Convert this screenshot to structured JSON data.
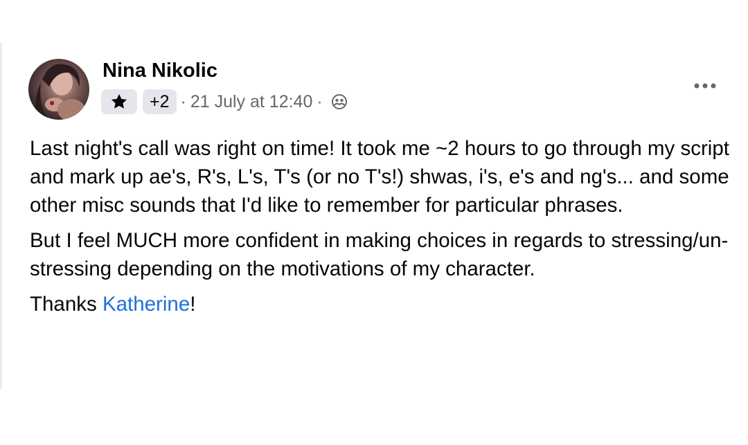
{
  "post": {
    "author_name": "Nina Nikolic",
    "badge_extra_count": "+2",
    "separator": "·",
    "timestamp": "21 July at 12:40",
    "privacy_icon": "friends-audience-icon",
    "badge_icon": "star-icon",
    "more_icon": "more-options-icon",
    "paragraphs": [
      "Last night's call was right on time! It took me ~2 hours to go through my script and mark up ae's, R's, L's, T's (or no T's!) shwas, i's, e's and ng's... and some other misc sounds that I'd like to remember for particular phrases.",
      "But I feel MUCH more confident in making choices in regards to stressing/un-stressing depending on the motivations of my character."
    ],
    "thanks_prefix": "Thanks ",
    "mention_name": "Katherine",
    "thanks_suffix": "!",
    "colors": {
      "text": "#050505",
      "secondary_text": "#65676b",
      "mention": "#216fdb",
      "badge_bg": "#e4e6eb"
    }
  }
}
